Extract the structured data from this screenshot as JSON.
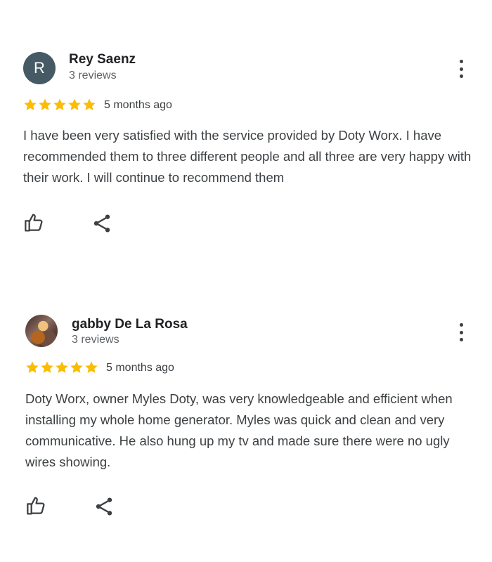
{
  "reviews": [
    {
      "avatar_letter": "R",
      "avatar_color": "#455a64",
      "name": "Rey Saenz",
      "review_count": "3 reviews",
      "rating": 5,
      "star_color": "#fbbc04",
      "time": "5 months ago",
      "text": "I have been very satisfied with the service provided by Doty Worx. I have recommended them to three different people and all three are very happy with their work. I will continue to recommend them",
      "icons": {
        "avatar": "letter-avatar",
        "more": "more-vert-icon",
        "like": "thumbs-up-icon",
        "share": "share-icon"
      }
    },
    {
      "avatar_letter": "",
      "avatar_color": "",
      "name": "gabby De La Rosa",
      "review_count": "3 reviews",
      "rating": 5,
      "star_color": "#fbbc04",
      "time": "5 months ago",
      "text": "Doty Worx, owner Myles Doty, was very knowledgeable and efficient when installing my whole home generator. Myles was quick and clean and very communicative. He also hung up my tv and made sure there were no ugly wires showing.",
      "icons": {
        "avatar": "photo-avatar",
        "more": "more-vert-icon",
        "like": "thumbs-up-icon",
        "share": "share-icon"
      }
    }
  ]
}
